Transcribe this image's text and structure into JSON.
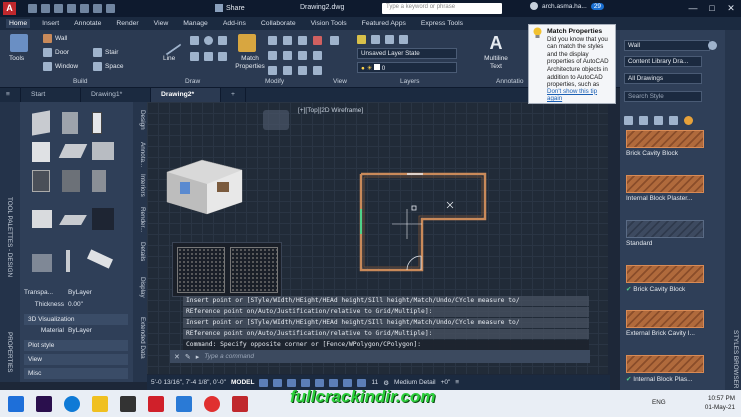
{
  "titlebar": {
    "app_logo": "A",
    "share_label": "Share",
    "document_title": "Drawing2.dwg",
    "search_placeholder": "Type a keyword or phrase",
    "user_name": "arch.asma.ha...",
    "notif_count": "29"
  },
  "ribbon_tabs": [
    "Home",
    "Insert",
    "Annotate",
    "Render",
    "View",
    "Manage",
    "Add-ins",
    "Collaborate",
    "Vision Tools",
    "Featured Apps",
    "Express Tools"
  ],
  "ribbon": {
    "tools_label": "Tools",
    "build": {
      "wall": "Wall",
      "door": "Door",
      "window": "Window",
      "stair": "Stair",
      "space": "Space",
      "panel": "Build"
    },
    "draw": {
      "line": "Line",
      "panel": "Draw"
    },
    "modify": {
      "match": "Match Properties",
      "panel": "Modify"
    },
    "view_panel": "View",
    "layers": {
      "layer_state": "Unsaved Layer State",
      "layer_current": "0",
      "panel": "Layers"
    },
    "annotation": {
      "multiline": "Multiline Text",
      "panel": "Annotatio"
    }
  },
  "doc_tabs": [
    "Start",
    "Drawing1*",
    "Drawing2*"
  ],
  "viewport_label": "[+][Top][2D Wireframe]",
  "left_strip": {
    "tool_palettes": "TOOL PALETTES - DESIGN",
    "properties": "PROPERTIES"
  },
  "palette_tabs": [
    "Design",
    "Annota...",
    "Interiors",
    "Render...",
    "Details",
    "Display",
    "Extended Data"
  ],
  "properties": {
    "rows": [
      {
        "label": "Transpa...",
        "value": "ByLayer"
      },
      {
        "label": "Thickness",
        "value": "0.00\""
      }
    ],
    "cat_3d": "3D Visualization",
    "material_label": "Material",
    "material_value": "ByLayer",
    "cat_plot": "Plot style",
    "cat_view": "View",
    "cat_misc": "Misc"
  },
  "command": {
    "history": [
      "Insert point or [STyle/WIdth/HEight/HEAd height/SIll height/Match/Undo/CYcle measure to/",
      "REference point on/Auto/Justification/relative to Grid/Multiple]:",
      "Insert point or [STyle/WIdth/HEight/HEAd height/SIll height/Match/Undo/CYcle measure to/",
      "REference point on/Auto/Justification/relative to Grid/Multiple]:",
      "Command: Specify opposite corner or [Fence/WPolygon/CPolygon]:"
    ],
    "input_placeholder": "Type a command"
  },
  "statusbar": {
    "coords": "5'-0 13/16\", 7'-4 1/8\", 0'-0\"",
    "model": "MODEL",
    "scale": "11",
    "detail": "Medium Detail",
    "elev": "+0\""
  },
  "right_palette": {
    "style": "Wall",
    "list_type": "Content Library Dra...",
    "drawings": "All Drawings",
    "search": "Search Style",
    "items": [
      "Brick Cavity Block",
      "Internal Block Plaster...",
      "Standard",
      "Brick Cavity Block",
      "External Brick Cavity I...",
      "Internal Block Plas..."
    ],
    "strip_label": "STYLES BROWSER"
  },
  "tooltip": {
    "title": "Match Properties",
    "body": "Did you know that you can match the styles and the display properties of AutoCAD Architecture objects in addition to AutoCAD properties, such as color and linetype?",
    "link": "Don't show this tip again"
  },
  "taskbar": {
    "lang": "ENG",
    "time": "10:57 PM",
    "date": "01-May-21"
  },
  "watermark": "fullcrackindir.com",
  "colors": {
    "accent": "#c0282d",
    "canvas": "#212b38",
    "ribbon": "#2b3a52",
    "wall_stroke": "#c98a5a"
  }
}
